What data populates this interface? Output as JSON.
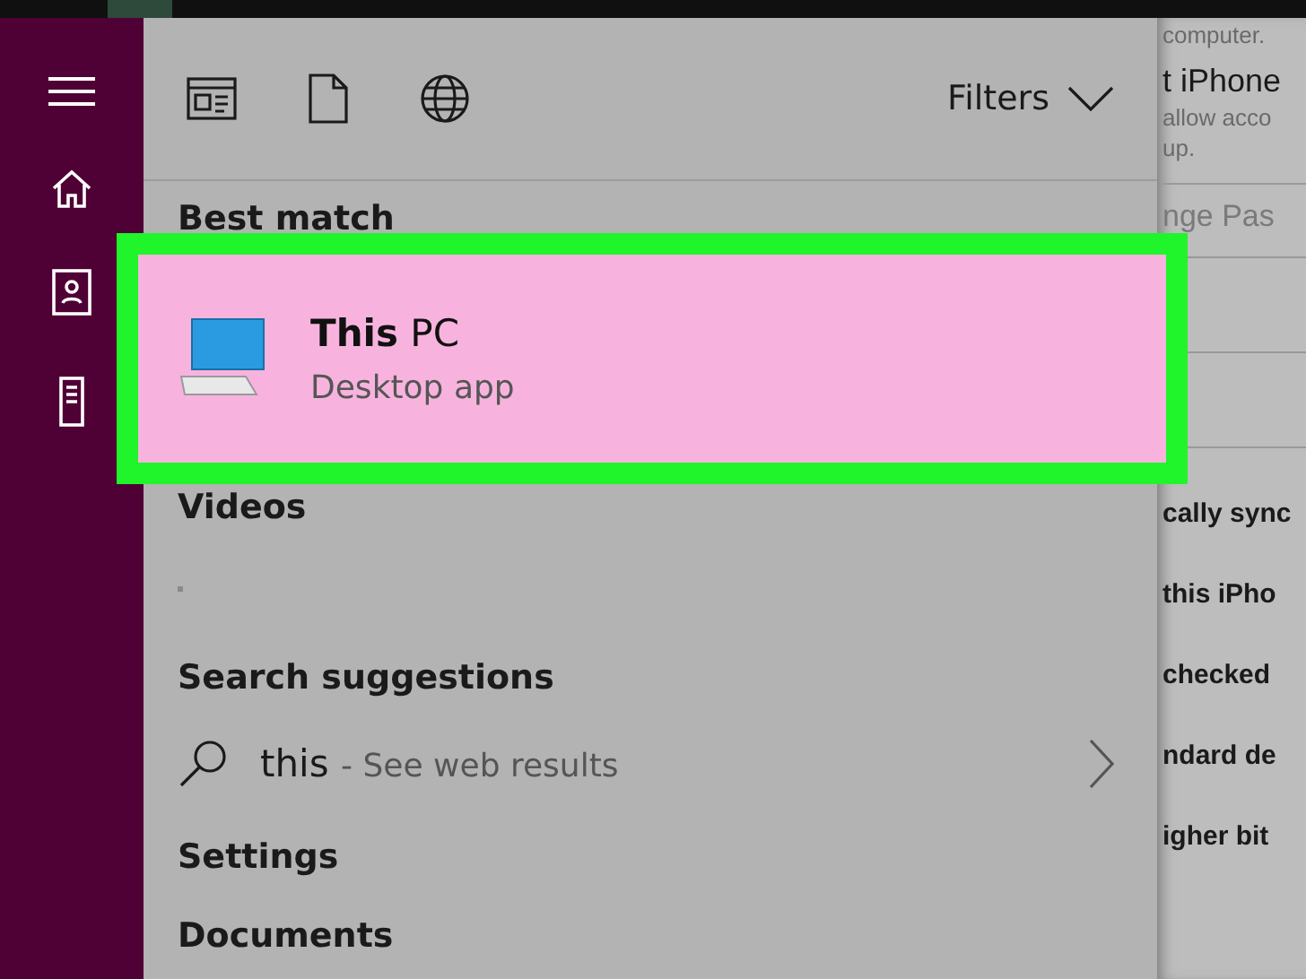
{
  "toolbar": {
    "filters": "Filters"
  },
  "best_match": {
    "heading": "Best match",
    "title": "**This** PC",
    "subtitle": "Desktop app",
    "selected": true
  },
  "sections": [
    {
      "kind": "heading",
      "label": "Videos"
    },
    {
      "kind": "dot"
    },
    {
      "kind": "heading",
      "label": "Search suggestions"
    },
    {
      "kind": "suggestion",
      "query": "this",
      "hint": "- See web results"
    },
    {
      "kind": "heading",
      "label": "Settings"
    },
    {
      "kind": "heading",
      "label": "Documents"
    }
  ],
  "background_window": {
    "lines": [
      {
        "kind": "note",
        "text": "computer."
      },
      {
        "kind": "title",
        "text": "t iPhone"
      },
      {
        "kind": "note",
        "text": "allow acco"
      },
      {
        "kind": "note",
        "text": "up."
      },
      {
        "kind": "rule"
      },
      {
        "kind": "faded",
        "text": "nge Pas"
      },
      {
        "kind": "rule"
      },
      {
        "kind": "gap"
      },
      {
        "kind": "rule"
      },
      {
        "kind": "gap"
      },
      {
        "kind": "rule"
      },
      {
        "kind": "item",
        "text": "cally sync"
      },
      {
        "kind": "item",
        "text": "this iPho"
      },
      {
        "kind": "item",
        "text": "checked"
      },
      {
        "kind": "item",
        "text": "ndard de"
      },
      {
        "kind": "item",
        "text": "igher bit"
      }
    ]
  }
}
